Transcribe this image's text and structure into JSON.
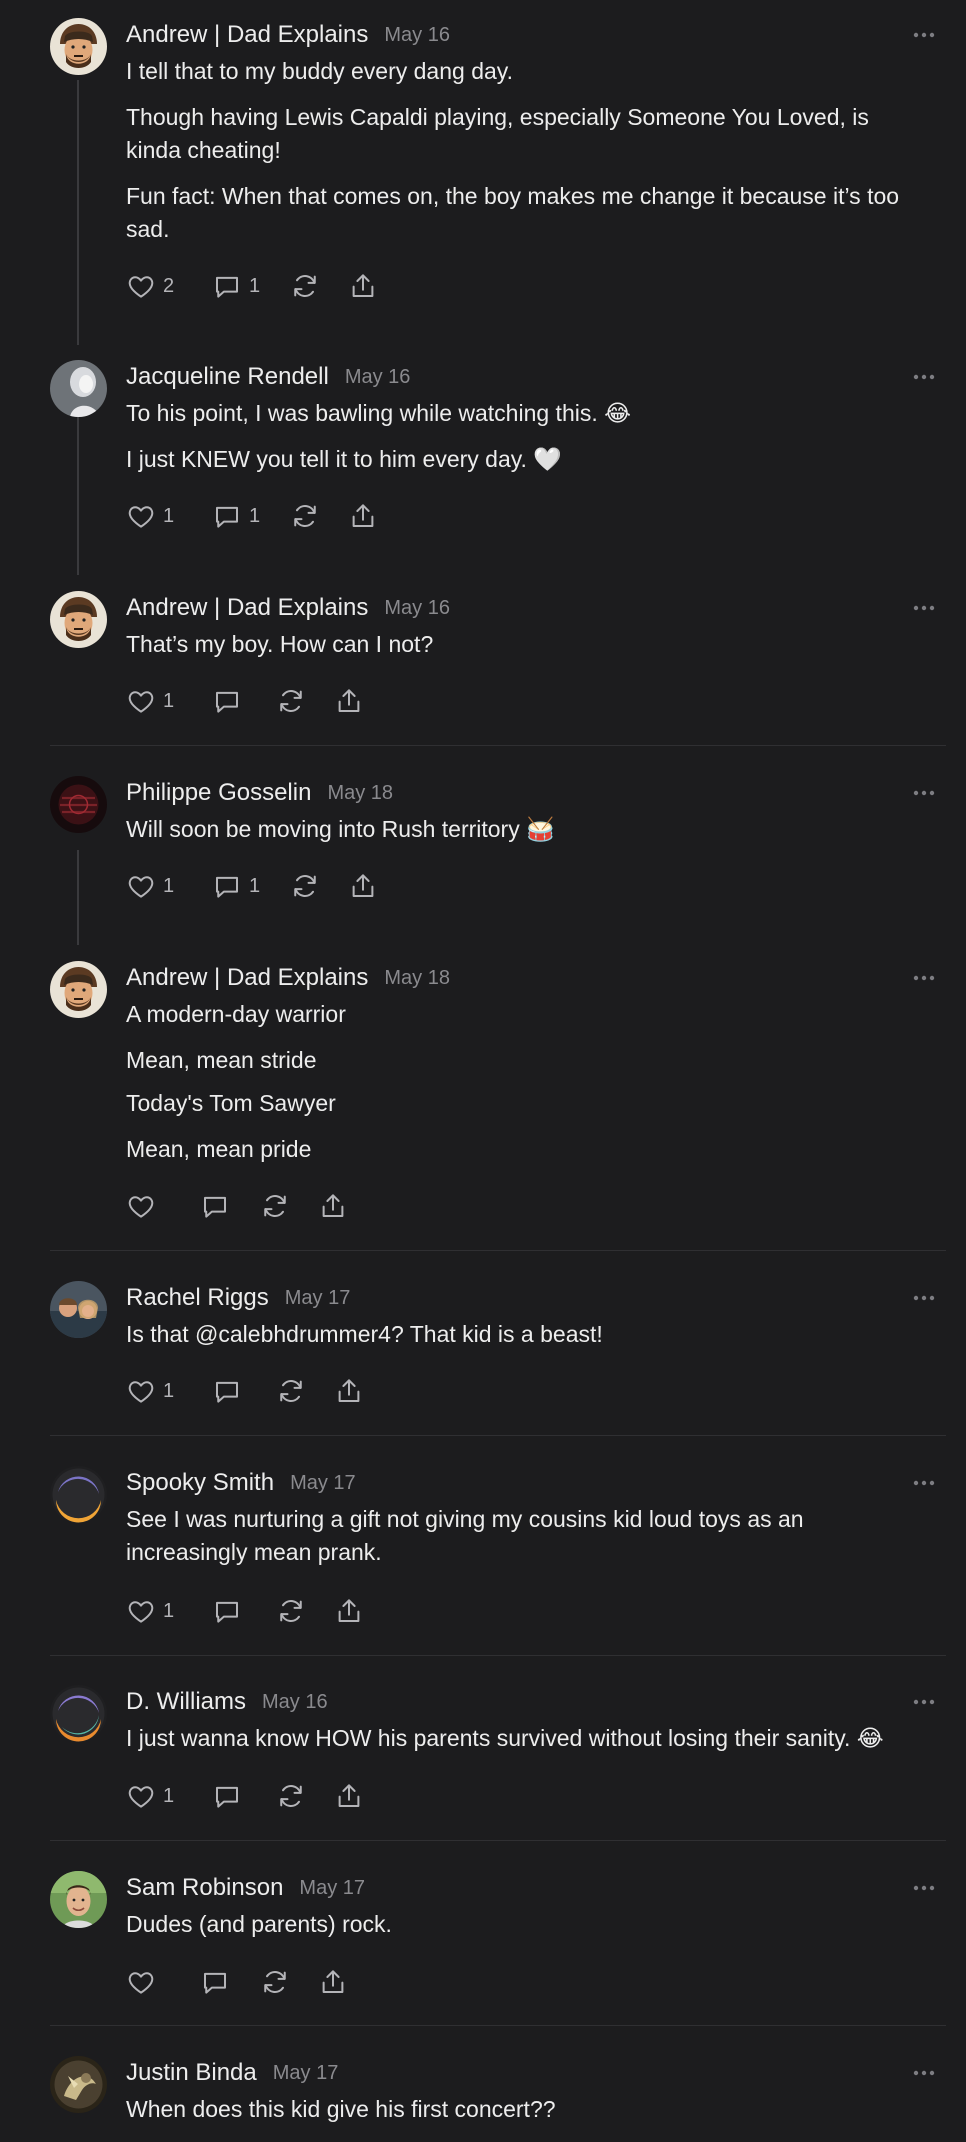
{
  "comments": [
    {
      "author": "Andrew | Dad Explains",
      "date": "May 16",
      "paragraphs": [
        "I tell that to my buddy every dang day.",
        "Though having Lewis Capaldi playing, especially Someone You Loved, is kinda cheating!",
        "Fun fact: When that comes on, the boy makes me change it because it’s too sad."
      ],
      "likes": "2",
      "replies": "1",
      "avatar": "andrew"
    },
    {
      "author": "Jacqueline Rendell",
      "date": "May 16",
      "paragraphs": [
        "To his point, I was bawling while watching this. 😂",
        "I just KNEW you tell it to him every day. 🤍"
      ],
      "likes": "1",
      "replies": "1",
      "avatar": "jacqueline"
    },
    {
      "author": "Andrew | Dad Explains",
      "date": "May 16",
      "paragraphs": [
        "That’s my boy. How can I not?"
      ],
      "likes": "1",
      "replies": "",
      "avatar": "andrew"
    },
    {
      "author": "Philippe Gosselin",
      "date": "May 18",
      "paragraphs": [
        "Will soon be moving into Rush territory 🥁"
      ],
      "likes": "1",
      "replies": "1",
      "avatar": "philippe"
    },
    {
      "author": "Andrew | Dad Explains",
      "date": "May 18",
      "paragraphs": [
        "A modern-day warrior",
        "Mean, mean stride",
        "Today's Tom Sawyer",
        "Mean, mean pride"
      ],
      "likes": "",
      "replies": "",
      "avatar": "andrew"
    },
    {
      "author": "Rachel Riggs",
      "date": "May 17",
      "paragraphs": [
        "Is that @calebhdrummer4? That kid is a beast!"
      ],
      "likes": "1",
      "replies": "",
      "avatar": "rachel"
    },
    {
      "author": "Spooky Smith",
      "date": "May 17",
      "paragraphs": [
        "See I was nurturing a gift not giving my cousins kid loud toys as an increasingly mean prank."
      ],
      "likes": "1",
      "replies": "",
      "avatar": "spooky"
    },
    {
      "author": "D. Williams",
      "date": "May 16",
      "paragraphs": [
        "I just wanna know HOW his parents survived without losing their sanity. 😂"
      ],
      "likes": "1",
      "replies": "",
      "avatar": "dwilliams"
    },
    {
      "author": "Sam Robinson",
      "date": "May 17",
      "paragraphs": [
        "Dudes (and parents) rock."
      ],
      "likes": "",
      "replies": "",
      "avatar": "sam"
    },
    {
      "author": "Justin Binda",
      "date": "May 17",
      "paragraphs": [
        "When does this kid give his first concert??"
      ],
      "likes": "",
      "replies": "",
      "avatar": "justin"
    }
  ],
  "icons": {
    "like": "heart-icon",
    "reply": "comment-bubble-icon",
    "restack": "restack-icon",
    "share": "share-icon",
    "more": "more-options-icon"
  },
  "colors": {
    "background": "#1c1c1e",
    "text": "#ececec",
    "muted": "#8a8a8e",
    "icon": "#b4b4b8",
    "thread_line": "#3a3a3d"
  }
}
